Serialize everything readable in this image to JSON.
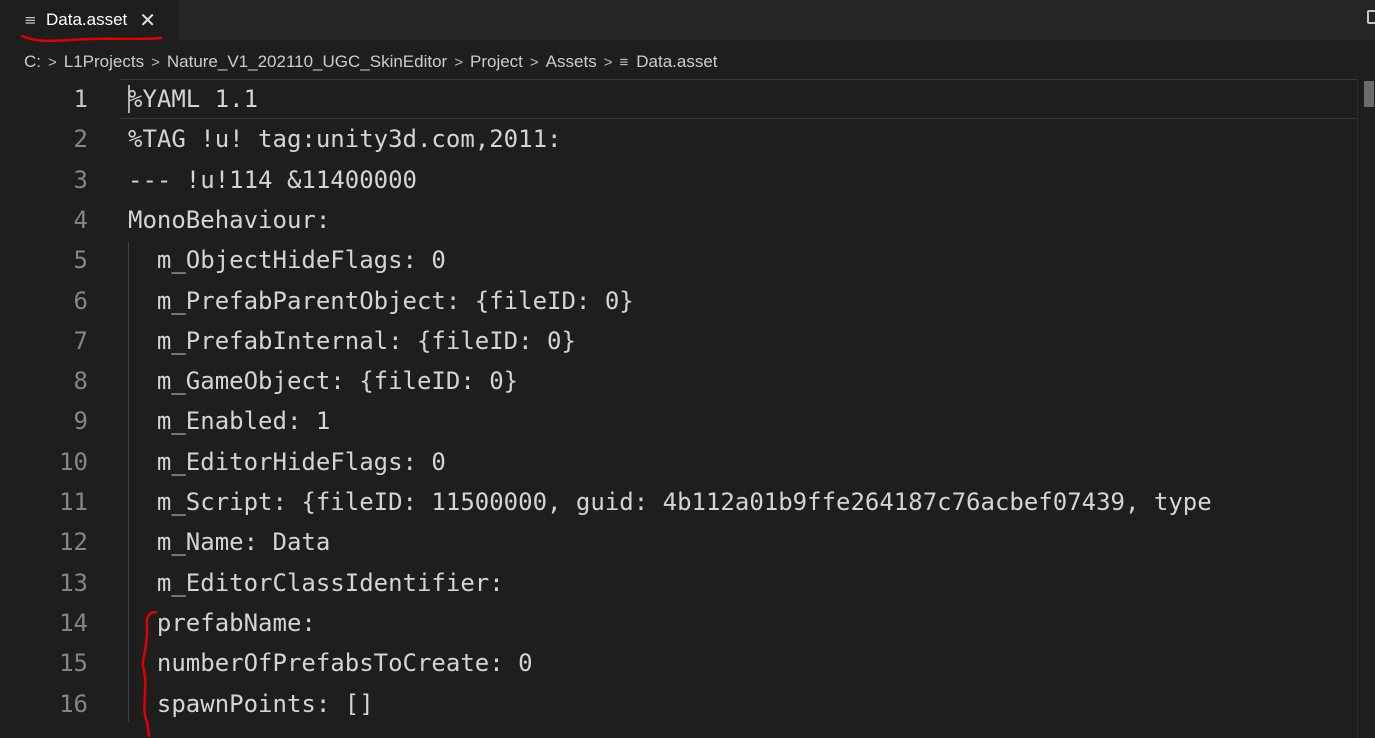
{
  "tab": {
    "icon": "lines-icon",
    "icon_glyph": "≡",
    "label": "Data.asset",
    "close_glyph": "✕"
  },
  "breadcrumb": {
    "items": [
      "C:",
      "L1Projects",
      "Nature_V1_202110_UGC_SkinEditor",
      "Project",
      "Assets"
    ],
    "separator": ">",
    "file_icon_glyph": "≡",
    "file_label": "Data.asset"
  },
  "editor": {
    "lines": [
      {
        "num": "1",
        "text": "%YAML 1.1"
      },
      {
        "num": "2",
        "text": "%TAG !u! tag:unity3d.com,2011:"
      },
      {
        "num": "3",
        "text": "--- !u!114 &11400000"
      },
      {
        "num": "4",
        "text": "MonoBehaviour:"
      },
      {
        "num": "5",
        "text": "  m_ObjectHideFlags: 0"
      },
      {
        "num": "6",
        "text": "  m_PrefabParentObject: {fileID: 0}"
      },
      {
        "num": "7",
        "text": "  m_PrefabInternal: {fileID: 0}"
      },
      {
        "num": "8",
        "text": "  m_GameObject: {fileID: 0}"
      },
      {
        "num": "9",
        "text": "  m_Enabled: 1"
      },
      {
        "num": "10",
        "text": "  m_EditorHideFlags: 0"
      },
      {
        "num": "11",
        "text": "  m_Script: {fileID: 11500000, guid: 4b112a01b9ffe264187c76acbef07439, type"
      },
      {
        "num": "12",
        "text": "  m_Name: Data"
      },
      {
        "num": "13",
        "text": "  m_EditorClassIdentifier:"
      },
      {
        "num": "14",
        "text": "  prefabName:"
      },
      {
        "num": "15",
        "text": "  numberOfPrefabsToCreate: 0"
      },
      {
        "num": "16",
        "text": "  spawnPoints: []"
      }
    ]
  },
  "colors": {
    "background": "#1e1e1e",
    "text": "#d4d4d4",
    "line_number": "#858585",
    "annotation": "#e00000"
  }
}
